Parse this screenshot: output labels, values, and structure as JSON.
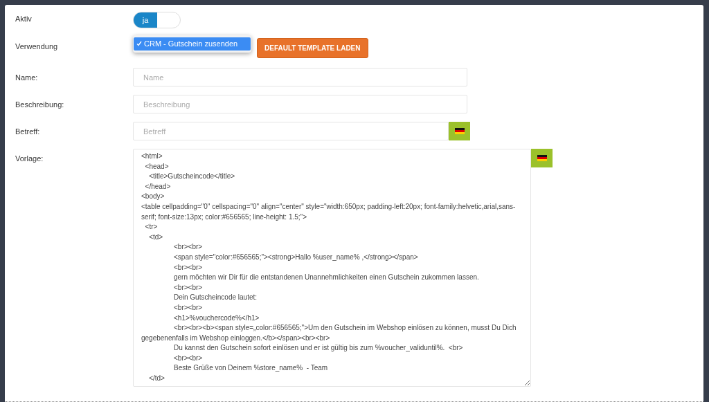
{
  "fields": [
    {
      "kind": "toggle",
      "label": "Aktiv",
      "text": "ja",
      "on": true
    },
    {
      "kind": "select",
      "label": "Verwendung",
      "options": [
        {
          "label": "CRM - Gutschein zusenden",
          "selected": true
        }
      ],
      "button": "DEFAULT TEMPLATE LADEN"
    },
    {
      "kind": "input",
      "label": "Name:",
      "placeholder": "Name"
    },
    {
      "kind": "input",
      "label": "Beschreibung:",
      "placeholder": "Beschreibung"
    },
    {
      "kind": "input_lang",
      "label": "Betreff:",
      "placeholder": "Betreff"
    },
    {
      "kind": "textarea_lang",
      "label": "Vorlage:",
      "lines": [
        "<html>",
        "  <head>",
        "    <title>Gutscheincode</title>",
        "  </head>",
        "<body>",
        "<table cellpadding=\"0\" cellspacing=\"0\" align=\"center\" style=\"width:650px; padding-left:20px; font-family:helvetic,arial,sans-serif; font-size:13px; color:#656565; line-height: 1.5;\">",
        "  <tr>",
        "    <td>",
        "\t<br><br>",
        "\t<span style=\"color:#656565;\"><strong>Hallo %user_name% ,</strong></span>",
        "\t<br><br>",
        "\tgern möchten wir Dir für die entstandenen Unannehmlichkeiten einen Gutschein zukommen lassen.",
        "\t<br><br>",
        "\tDein Gutscheincode lautet:",
        "\t<br><br>",
        "\t<h1>%vouchercode%</h1>",
        "\t<br><br><b><span style=„color:#656565;\">Um den Gutschein im Webshop einlösen zu können, musst Du Dich gegebenenfalls im Webshop einloggen.</b></span><br><br>",
        "\tDu kannst den Gutschein sofort einlösen und er ist gültig bis zum %voucher_validuntil%.  <br>",
        "\t<br><br>",
        "\tBeste Grüße von Deinem %store_name%  - Team",
        "    </td>"
      ]
    }
  ]
}
